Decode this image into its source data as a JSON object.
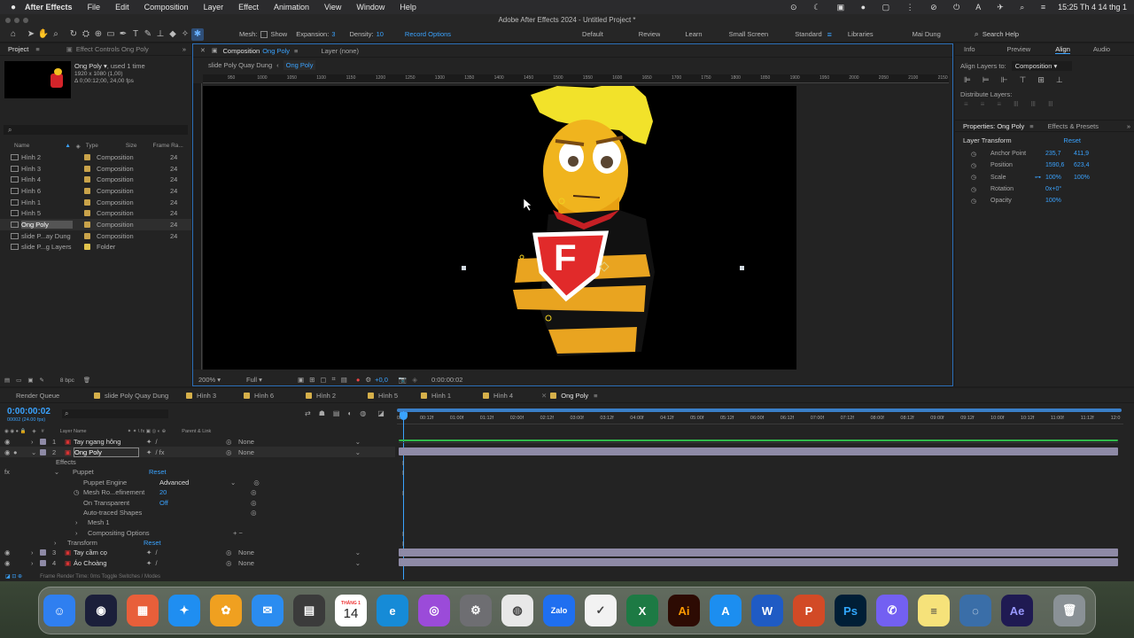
{
  "menubar": {
    "app_name": "After Effects",
    "items": [
      "File",
      "Edit",
      "Composition",
      "Layer",
      "Effect",
      "Animation",
      "View",
      "Window",
      "Help"
    ],
    "clock": "15:25 Th 4 14 thg 1"
  },
  "window_title": "Adobe After Effects 2024 - Untitled Project *",
  "toolbar": {
    "mesh_label": "Mesh:",
    "show_label": "Show",
    "expansion_label": "Expansion:",
    "expansion_value": "3",
    "density_label": "Density:",
    "density_value": "10",
    "record_options": "Record Options",
    "workspaces": [
      "Default",
      "Review",
      "Learn",
      "Small Screen",
      "Standard",
      "Libraries",
      "Mai Dung"
    ],
    "search_help": "Search Help"
  },
  "project_panel": {
    "tab_project": "Project",
    "tab_effect_controls": "Effect Controls Ong Poly",
    "selected_name": "Ong Poly",
    "selected_usage": ", used 1 time",
    "selected_size": "1920 x 1080 (1,00)",
    "selected_duration": "Δ 0;00:12;00, 24,00 fps",
    "search_placeholder": "",
    "columns": {
      "name": "Name",
      "type": "Type",
      "size": "Size",
      "frame_rate": "Frame Ra..."
    },
    "items": [
      {
        "name": "Hình 2",
        "type": "Composition",
        "fps": "24",
        "color": "#c9a34a"
      },
      {
        "name": "Hình 3",
        "type": "Composition",
        "fps": "24",
        "color": "#c9a34a"
      },
      {
        "name": "Hình 4",
        "type": "Composition",
        "fps": "24",
        "color": "#c9a34a"
      },
      {
        "name": "Hình 6",
        "type": "Composition",
        "fps": "24",
        "color": "#c9a34a"
      },
      {
        "name": "Hình 1",
        "type": "Composition",
        "fps": "24",
        "color": "#c9a34a"
      },
      {
        "name": "Hình 5",
        "type": "Composition",
        "fps": "24",
        "color": "#c9a34a"
      },
      {
        "name": "Ong Poly",
        "type": "Composition",
        "fps": "24",
        "color": "#c9a34a"
      },
      {
        "name": "slide P...ay Dung",
        "type": "Composition",
        "fps": "24",
        "color": "#c9a34a"
      },
      {
        "name": "slide P...g Layers",
        "type": "Folder",
        "fps": "",
        "color": "#e0c34c"
      }
    ],
    "bpc": "8 bpc"
  },
  "viewer": {
    "tab_composition": "Composition",
    "tab_comp_name": "Ong Poly",
    "tab_layer": "Layer (none)",
    "breadcrumb_parent": "slide Poly Quay Dung",
    "breadcrumb_current": "Ong Poly",
    "ruler_labels": [
      "950",
      "1000",
      "1050",
      "1100",
      "1150",
      "1200",
      "1250",
      "1300",
      "1350",
      "1400",
      "1450",
      "1500",
      "1550",
      "1600",
      "1650",
      "1700",
      "1750",
      "1800",
      "1850",
      "1900",
      "1950",
      "2000",
      "2050",
      "2100",
      "2150"
    ],
    "zoom": "200%",
    "resolution": "Full",
    "exposure": "+0,0",
    "timecode": "0:00:00:02",
    "character_letter": "F"
  },
  "right_panel": {
    "tabs": [
      "Info",
      "Preview",
      "Align",
      "Audio"
    ],
    "align_layers_to_label": "Align Layers to:",
    "align_layers_to_value": "Composition",
    "distribute_label": "Distribute Layers:",
    "properties_tab": "Properties: Ong Poly",
    "effects_presets_tab": "Effects & Presets",
    "layer_transform": "Layer Transform",
    "reset": "Reset",
    "props": [
      {
        "label": "Anchor Point",
        "v1": "235,7",
        "v2": "411,9"
      },
      {
        "label": "Position",
        "v1": "1590,6",
        "v2": "623,4"
      },
      {
        "label": "Scale",
        "v1": "100%",
        "v2": "100%"
      },
      {
        "label": "Rotation",
        "v1": "0x+0°",
        "v2": ""
      },
      {
        "label": "Opacity",
        "v1": "100%",
        "v2": ""
      }
    ]
  },
  "timeline": {
    "tabs": [
      "Render Queue",
      "slide Poly Quay Dung",
      "Hình 3",
      "Hình 6",
      "Hình 2",
      "Hình 5",
      "Hình 1",
      "Hình 4",
      "Ong Poly"
    ],
    "current_time": "0:00:00:02",
    "current_frames": "00002 (24.00 fps)",
    "col_layer_name": "Layer Name",
    "col_parent": "Parent & Link",
    "ruler": [
      "0f",
      "00:12f",
      "01:00f",
      "01:12f",
      "02:00f",
      "02:12f",
      "03:00f",
      "03:12f",
      "04:00f",
      "04:12f",
      "05:00f",
      "05:12f",
      "06:00f",
      "06:12f",
      "07:00f",
      "07:12f",
      "08:00f",
      "08:12f",
      "09:00f",
      "09:12f",
      "10:00f",
      "10:12f",
      "11:00f",
      "11:12f",
      "12:0"
    ],
    "layers": [
      {
        "num": "1",
        "name": "Tay ngang hông",
        "parent": "None"
      },
      {
        "num": "2",
        "name": "Ong Poly",
        "parent": "None"
      },
      {
        "num": "3",
        "name": "Tay cầm cọ",
        "parent": "None"
      },
      {
        "num": "4",
        "name": "Áo Choàng",
        "parent": "None"
      }
    ],
    "props": {
      "effects": "Effects",
      "puppet": "Puppet",
      "reset": "Reset",
      "puppet_engine": "Puppet Engine",
      "puppet_engine_value": "Advanced",
      "mesh_refinement": "Mesh Ro...efinement",
      "mesh_refinement_value": "20",
      "on_transparent": "On Transparent",
      "on_transparent_value": "Off",
      "auto_traced": "Auto-traced Shapes",
      "mesh1": "Mesh 1",
      "compositing": "Compositing Options",
      "transform": "Transform",
      "transform_reset": "Reset"
    },
    "footer": "Frame Render Time: 0ms     Toggle Switches / Modes"
  },
  "dock": {
    "calendar_month": "THÁNG 1",
    "calendar_day": "14",
    "apps": [
      {
        "name": "Finder",
        "glyph": "☺",
        "color": "#2f7ff0"
      },
      {
        "name": "Cinema",
        "glyph": "◉",
        "color": "#1b1f3a"
      },
      {
        "name": "Launchpad",
        "glyph": "▦",
        "color": "#e85f3a"
      },
      {
        "name": "Safari",
        "glyph": "✦",
        "color": "#1f8ef1"
      },
      {
        "name": "Photos",
        "glyph": "✿",
        "color": "#f0a020"
      },
      {
        "name": "Mail",
        "glyph": "✉",
        "color": "#2b8cf0"
      },
      {
        "name": "Calculator",
        "glyph": "▤",
        "color": "#3b3b3b"
      },
      {
        "name": "Calendar",
        "glyph": "",
        "color": "#ffffff"
      },
      {
        "name": "Edge",
        "glyph": "e",
        "color": "#168bd7"
      },
      {
        "name": "Podcasts",
        "glyph": "◎",
        "color": "#9b4bd9"
      },
      {
        "name": "Settings",
        "glyph": "⚙",
        "color": "#6e6e72"
      },
      {
        "name": "Chrome",
        "glyph": "◍",
        "color": "#e8e8e8"
      },
      {
        "name": "Zalo",
        "glyph": "Zalo",
        "color": "#1f6ff0"
      },
      {
        "name": "Sheets",
        "glyph": "✓",
        "color": "#f2f2f2"
      },
      {
        "name": "Excel",
        "glyph": "X",
        "color": "#1d7a44"
      },
      {
        "name": "Illustrator",
        "glyph": "Ai",
        "color": "#2d0b03"
      },
      {
        "name": "AppStore",
        "glyph": "A",
        "color": "#1c8ef0"
      },
      {
        "name": "Word",
        "glyph": "W",
        "color": "#1f5bc4"
      },
      {
        "name": "PowerPoint",
        "glyph": "P",
        "color": "#d24a26"
      },
      {
        "name": "Photoshop",
        "glyph": "Ps",
        "color": "#001e36"
      },
      {
        "name": "Viber",
        "glyph": "✆",
        "color": "#7360f2"
      },
      {
        "name": "Notes",
        "glyph": "≡",
        "color": "#f6e27a"
      },
      {
        "name": "QuickTime",
        "glyph": "◌",
        "color": "#3a6ea8"
      },
      {
        "name": "AfterEffects",
        "glyph": "Ae",
        "color": "#1f1a52"
      },
      {
        "name": "Trash",
        "glyph": "🗑",
        "color": "#8a9196"
      }
    ]
  },
  "colors": {
    "accent": "#3aa3ff",
    "bar": "#8e8aa6",
    "label_yellow": "#d6b04a"
  }
}
